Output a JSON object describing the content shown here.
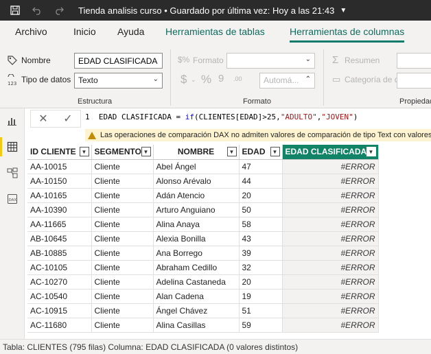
{
  "titlebar": {
    "title": "Tienda analisis curso • Guardado por última vez: Hoy a las 21:43",
    "save_icon": "save-icon",
    "undo_icon": "undo-icon",
    "redo_icon": "redo-icon"
  },
  "ribbon_tabs": [
    {
      "label": "Archivo"
    },
    {
      "label": "Inicio"
    },
    {
      "label": "Ayuda"
    },
    {
      "label": "Herramientas de tablas"
    },
    {
      "label": "Herramientas de columnas"
    }
  ],
  "ribbon": {
    "nombre_label": "Nombre",
    "nombre_value": "EDAD CLASIFICADA",
    "tipo_label": "Tipo de datos",
    "tipo_value": "Texto",
    "estructura_label": "Estructura",
    "formato_label": "Formato",
    "formato_group_label": "Formato",
    "auto_value": "Automá...",
    "resumen_label": "Resumen",
    "categoria_label": "Categoría de datos",
    "propiedades_label": "Propiedade"
  },
  "formula": {
    "line_number": "1",
    "prefix": "EDAD CLASIFICADA = ",
    "fn": "if",
    "args_open": "(CLIENTES[EDAD]>25,",
    "str1": "\"ADULTO\"",
    "comma": ",",
    "str2": "\"JOVEN\"",
    "close": ")"
  },
  "warning": {
    "text": "Las operaciones de comparación DAX no admiten valores de comparación de tipo Text con valores de tipo"
  },
  "table": {
    "columns": [
      "ID CLIENTE",
      "SEGMENTO",
      "NOMBRE",
      "EDAD",
      "EDAD CLASIFICADA"
    ],
    "rows": [
      [
        "AA-10015",
        "Cliente",
        "Abel Ángel",
        "47",
        "#ERROR"
      ],
      [
        "AA-10150",
        "Cliente",
        "Alonso Arévalo",
        "44",
        "#ERROR"
      ],
      [
        "AA-10165",
        "Cliente",
        "Adán Atencio",
        "20",
        "#ERROR"
      ],
      [
        "AA-10390",
        "Cliente",
        "Arturo Anguiano",
        "50",
        "#ERROR"
      ],
      [
        "AA-11665",
        "Cliente",
        "Alina Anaya",
        "58",
        "#ERROR"
      ],
      [
        "AB-10645",
        "Cliente",
        "Alexia Bonilla",
        "43",
        "#ERROR"
      ],
      [
        "AB-10885",
        "Cliente",
        "Ana Borrego",
        "39",
        "#ERROR"
      ],
      [
        "AC-10105",
        "Cliente",
        "Abraham Cedillo",
        "32",
        "#ERROR"
      ],
      [
        "AC-10270",
        "Cliente",
        "Adelina Castaneda",
        "20",
        "#ERROR"
      ],
      [
        "AC-10540",
        "Cliente",
        "Alan Cadena",
        "19",
        "#ERROR"
      ],
      [
        "AC-10915",
        "Cliente",
        "Ángel Chávez",
        "51",
        "#ERROR"
      ],
      [
        "AC-11680",
        "Cliente",
        "Alina Casillas",
        "59",
        "#ERROR"
      ]
    ]
  },
  "status": {
    "text": "Tabla: CLIENTES (795 filas) Columna: EDAD CLASIFICADA (0 valores distintos)"
  },
  "colors": {
    "accent": "#118367",
    "titlebar": "#2b2b2b",
    "warning_bg": "#fdf3d0"
  }
}
